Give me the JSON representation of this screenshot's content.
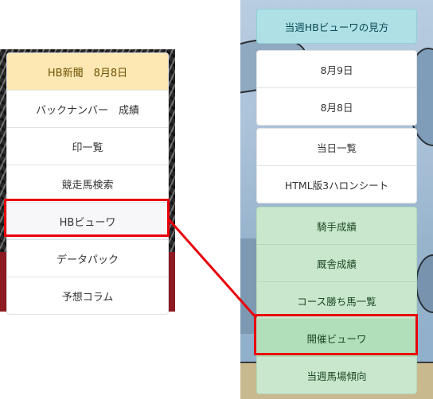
{
  "left_menu": {
    "items": [
      {
        "label": "HB新聞　8月8日",
        "state": "highlighted"
      },
      {
        "label": "バックナンバー　成績"
      },
      {
        "label": "印一覧"
      },
      {
        "label": "競走馬検索"
      },
      {
        "label": "HBビューワ",
        "state": "annotated"
      },
      {
        "label": "データパック"
      },
      {
        "label": "予想コラム"
      }
    ]
  },
  "right_menu": {
    "top_button": "当週HBビューワの見方",
    "date_group": [
      "8月9日",
      "8月8日"
    ],
    "tool_group": [
      "当日一覧",
      "HTML版3ハロンシート"
    ],
    "green_group": [
      "騎手成績",
      "厩舎成績",
      "コース勝ち馬一覧",
      "開催ビューワ",
      "当週馬場傾向"
    ]
  },
  "colors": {
    "highlight_yellow": "#fde8b4",
    "top_button_cyan": "#aee0e6",
    "green_button": "#c8e7cd",
    "annotation_red": "#e8000b"
  }
}
